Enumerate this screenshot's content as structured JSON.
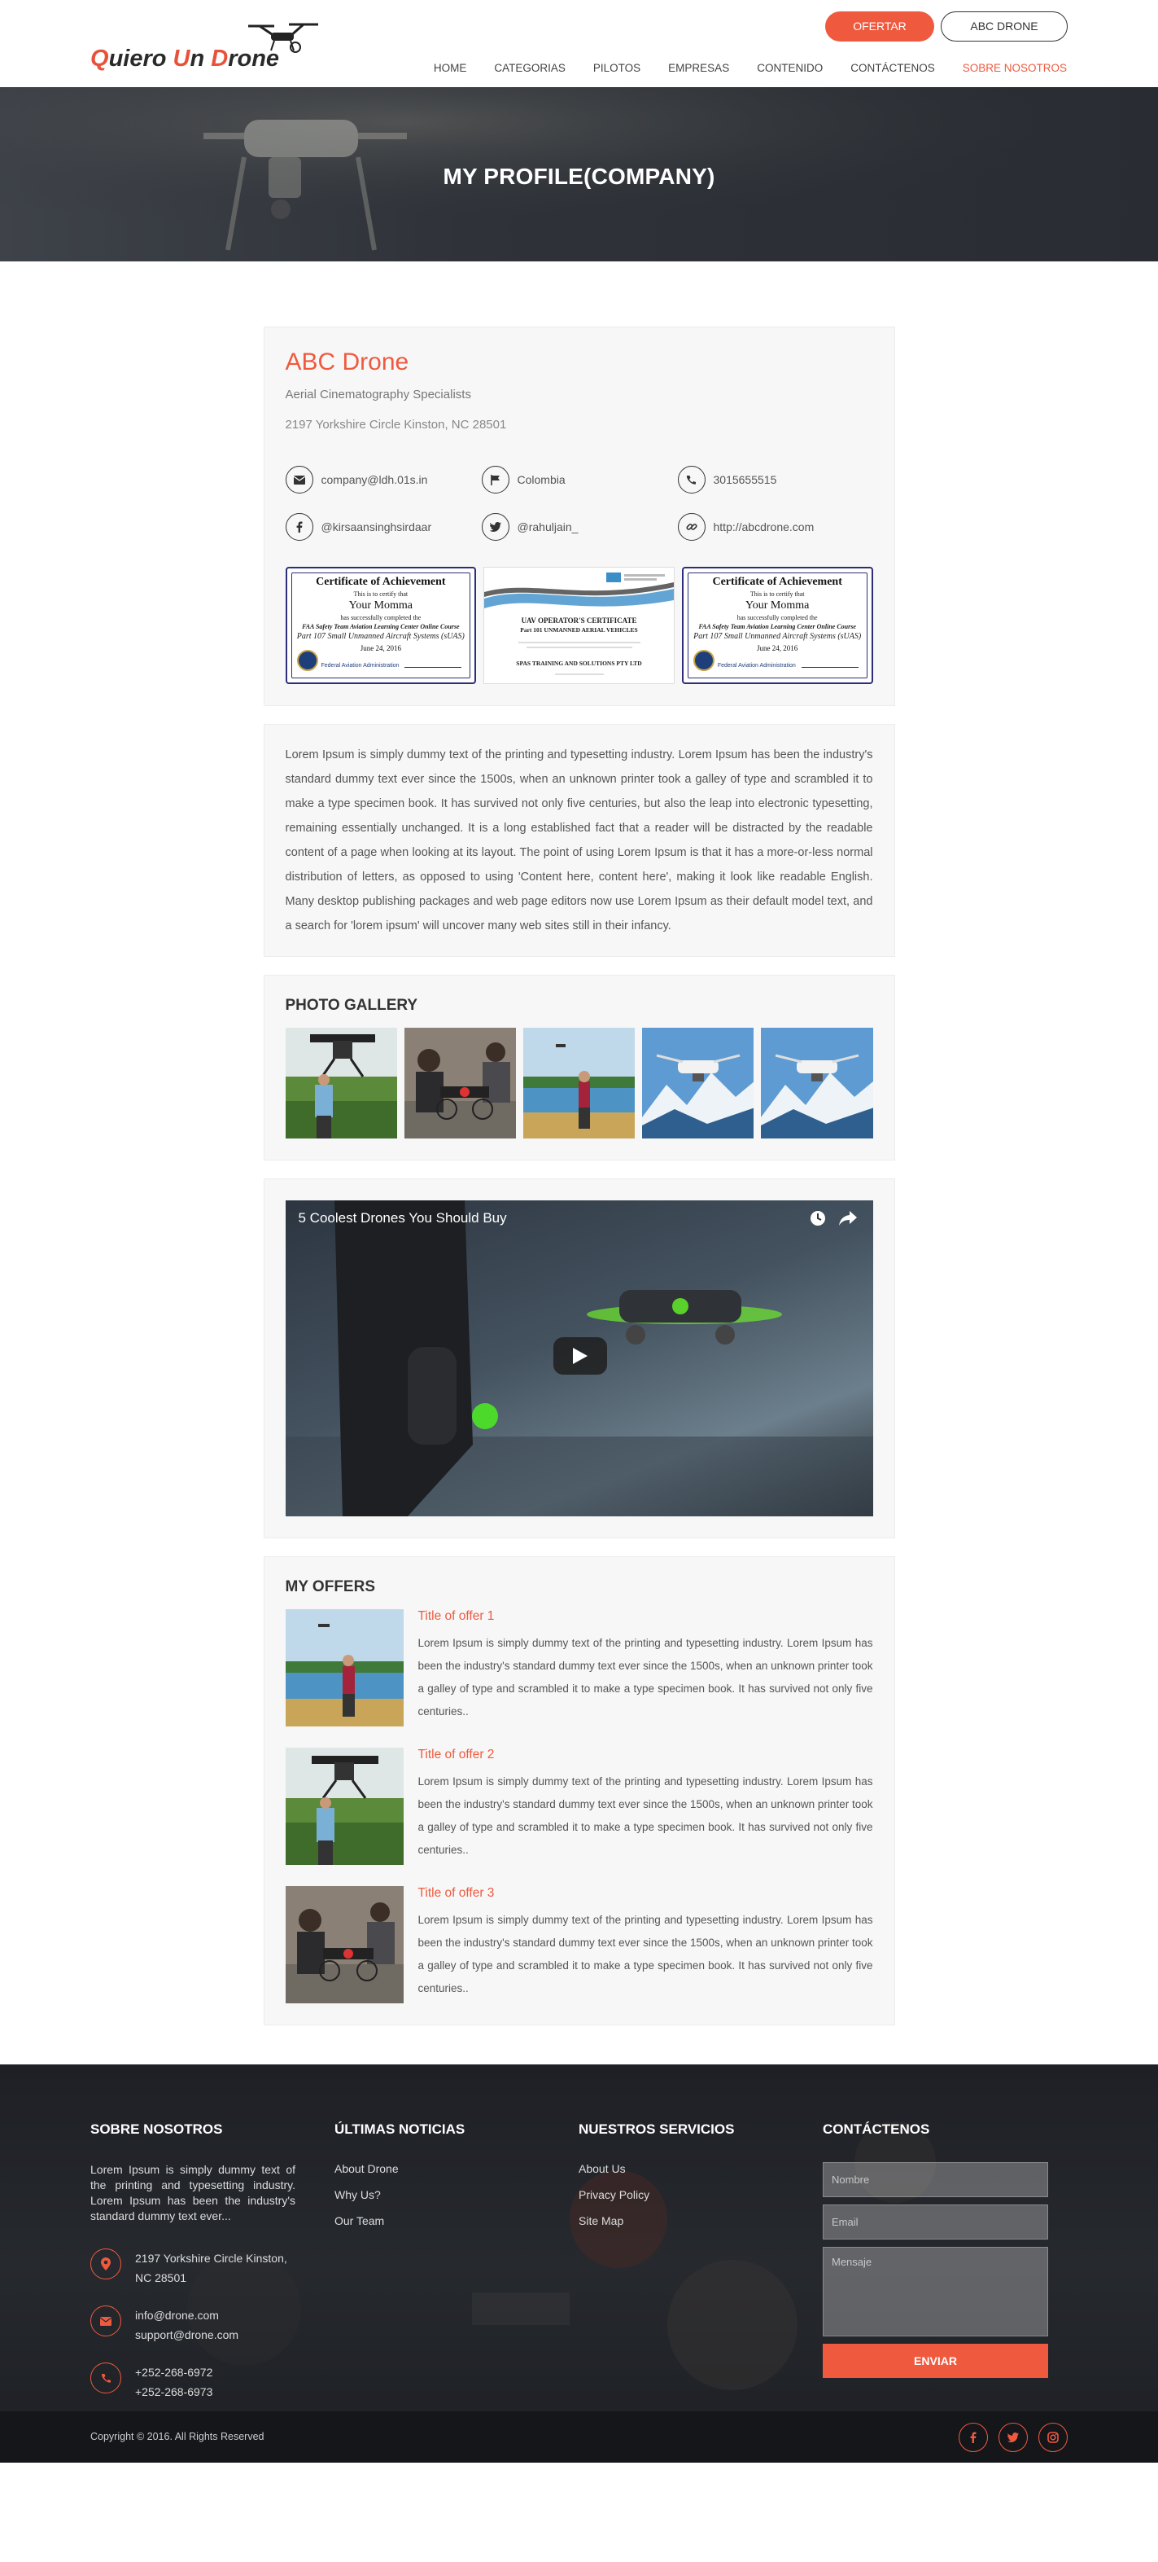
{
  "header": {
    "logo": {
      "part1": "Q",
      "part2": "uiero ",
      "part3": "U",
      "part4": "n ",
      "part5": "D",
      "part6": "rone"
    },
    "offer_button": "OFERTAR",
    "user_button": "ABC DRONE",
    "nav": [
      "HOME",
      "CATEGORIAS",
      "PILOTOS",
      "EMPRESAS",
      "CONTENIDO",
      "CONTÁCTENOS",
      "SOBRE NOSOTROS"
    ],
    "active_nav": "SOBRE NOSOTROS"
  },
  "banner": {
    "title": "MY PROFILE(COMPANY)"
  },
  "profile": {
    "name": "ABC Drone",
    "tagline": "Aerial Cinematography Specialists",
    "address": "2197 Yorkshire Circle Kinston, NC 28501",
    "contacts": [
      {
        "icon": "envelope-icon",
        "value": "company@ldh.01s.in"
      },
      {
        "icon": "flag-icon",
        "value": "Colombia"
      },
      {
        "icon": "phone-icon",
        "value": "3015655515"
      },
      {
        "icon": "facebook-icon",
        "value": "@kirsaansinghsirdaar"
      },
      {
        "icon": "twitter-icon",
        "value": "@rahuljain_"
      },
      {
        "icon": "link-icon",
        "value": "http://abcdrone.com"
      }
    ],
    "certificates": {
      "faa": {
        "title": "Certificate of Achievement",
        "certify": "This is to certify that",
        "name": "Your Momma",
        "completed": "has successfully completed the",
        "course": "FAA Safety Team Aviation Learning Center Online Course",
        "part": "Part 107 Small Unmanned Aircraft Systems (sUAS)",
        "date": "June 24, 2016",
        "org": "Federal Aviation Administration"
      },
      "uav": {
        "heading": "UAV OPERATOR'S CERTIFICATE",
        "sub": "Part 101 UNMANNED AERIAL VEHICLES",
        "company": "SPAS TRAINING AND SOLUTIONS PTY LTD"
      }
    }
  },
  "about": {
    "text": "Lorem Ipsum is simply dummy text of the printing and typesetting industry. Lorem Ipsum has been the industry's standard dummy text ever since the 1500s, when an unknown printer took a galley of type and scrambled it to make a type specimen book. It has survived not only five centuries, but also the leap into electronic typesetting, remaining essentially unchanged. It is a long established fact that a reader will be distracted by the readable content of a page when looking at its layout. The point of using Lorem Ipsum is that it has a more-or-less normal distribution of letters, as opposed to using 'Content here, content here', making it look like readable English. Many desktop publishing packages and web page editors now use Lorem Ipsum as their default model text, and a search for 'lorem ipsum' will uncover many web sites still in their infancy."
  },
  "gallery": {
    "title": "PHOTO GALLERY"
  },
  "video": {
    "title": "5 Coolest Drones You Should Buy"
  },
  "offers": {
    "title": "MY OFFERS",
    "items": [
      {
        "title": "Title of offer 1",
        "text": "Lorem Ipsum is simply dummy text of the printing and typesetting industry. Lorem Ipsum has been the industry's standard dummy text ever since the 1500s, when an unknown printer took a galley of type and scrambled it to make a type specimen book. It has survived not only five centuries.."
      },
      {
        "title": "Title of offer 2",
        "text": "Lorem Ipsum is simply dummy text of the printing and typesetting industry. Lorem Ipsum has been the industry's standard dummy text ever since the 1500s, when an unknown printer took a galley of type and scrambled it to make a type specimen book. It has survived not only five centuries.."
      },
      {
        "title": "Title of offer 3",
        "text": "Lorem Ipsum is simply dummy text of the printing and typesetting industry. Lorem Ipsum has been the industry's standard dummy text ever since the 1500s, when an unknown printer took a galley of type and scrambled it to make a type specimen book. It has survived not only five centuries.."
      }
    ]
  },
  "footer": {
    "about": {
      "title": "SOBRE NOSOTROS",
      "text": "Lorem Ipsum is simply dummy text of the printing and typesetting industry. Lorem Ipsum has been the industry's standard dummy text ever...",
      "address_line1": "2197 Yorkshire Circle Kinston,",
      "address_line2": "NC 28501",
      "email1": "info@drone.com",
      "email2": "support@drone.com",
      "phone1": "+252-268-6972",
      "phone2": "+252-268-6973"
    },
    "news": {
      "title": "ÚLTIMAS NOTICIAS",
      "items": [
        "About Drone",
        "Why Us?",
        "Our Team"
      ]
    },
    "services": {
      "title": "NUESTROS SERVICIOS",
      "items": [
        "About Us",
        "Privacy Policy",
        "Site Map"
      ]
    },
    "contact": {
      "title": "CONTÁCTENOS",
      "name_placeholder": "Nombre",
      "email_placeholder": "Email",
      "message_placeholder": "Mensaje",
      "submit": "ENVIAR"
    },
    "copyright": "Copyright © 2016. All Rights Reserved"
  },
  "colors": {
    "accent": "#ef5a3f",
    "dark": "#1e2025"
  }
}
